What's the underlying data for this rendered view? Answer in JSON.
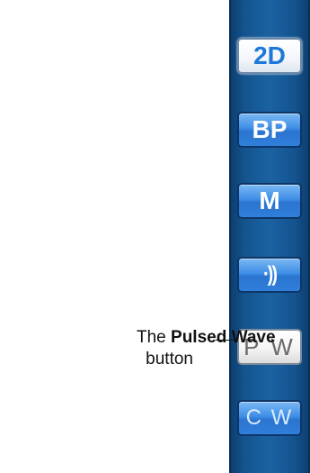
{
  "toolbar": {
    "buttons": [
      {
        "label": "2D",
        "state": "selected"
      },
      {
        "label": "BP",
        "state": "normal"
      },
      {
        "label": "M",
        "state": "normal"
      },
      {
        "icon": "wave-signal-icon",
        "state": "normal"
      },
      {
        "label": "P W",
        "state": "highlighted"
      },
      {
        "label": "C W",
        "state": "normal"
      }
    ]
  },
  "callout": {
    "prefix": "The ",
    "bold": "Pulsed Wave",
    "suffix": "button"
  },
  "colors": {
    "toolbar_bg": "#1b62a2",
    "button_blue": "#3f8ee6",
    "button_selected_text": "#1e78d8",
    "button_pw_text": "#6a6a6a"
  }
}
